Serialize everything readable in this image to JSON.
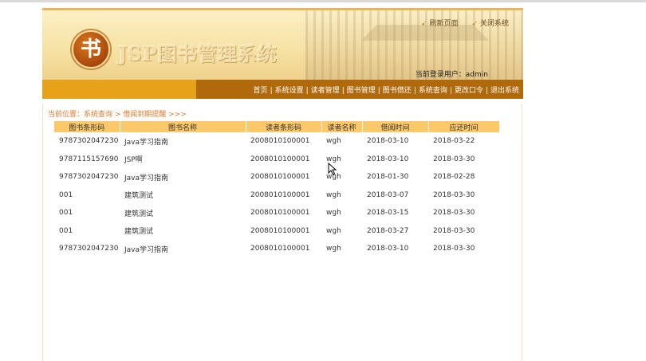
{
  "header": {
    "logo_char": "书",
    "app_title": "JSP图书管理系统",
    "refresh_link": "刷新页面",
    "close_link": "关闭系统",
    "current_user_label": "当前登录用户：admin"
  },
  "nav": {
    "items": [
      "首页",
      "系统设置",
      "读者管理",
      "图书管理",
      "图书借还",
      "系统查询",
      "更改口令",
      "退出系统"
    ]
  },
  "breadcrumb": "当前位置：系统查询 > 借阅到期提醒 >>>",
  "table": {
    "columns": [
      "图书条形码",
      "图书名称",
      "读者条形码",
      "读者名称",
      "借阅时间",
      "应还时间"
    ],
    "rows": [
      [
        "9787302047230",
        "Java学习指南",
        "2008010100001",
        "wgh",
        "2018-03-10",
        "2018-03-22"
      ],
      [
        "9787115157690",
        "JSP啊",
        "2008010100001",
        "wgh",
        "2018-03-10",
        "2018-03-30"
      ],
      [
        "9787302047230",
        "Java学习指南",
        "2008010100001",
        "wgh",
        "2018-01-30",
        "2018-02-28"
      ],
      [
        "001",
        "建筑测试",
        "2008010100001",
        "wgh",
        "2018-03-07",
        "2018-03-30"
      ],
      [
        "001",
        "建筑测试",
        "2008010100001",
        "wgh",
        "2018-03-15",
        "2018-03-30"
      ],
      [
        "001",
        "建筑测试",
        "2008010100001",
        "wgh",
        "2018-03-27",
        "2018-03-30"
      ],
      [
        "9787302047230",
        "Java学习指南",
        "2008010100001",
        "wgh",
        "2018-03-10",
        "2018-03-30"
      ]
    ]
  },
  "colors": {
    "nav_left": "#e8a21a",
    "nav_right": "#b06a0c",
    "table_header": "#fcc96a",
    "breadcrumb": "#e07a28"
  }
}
